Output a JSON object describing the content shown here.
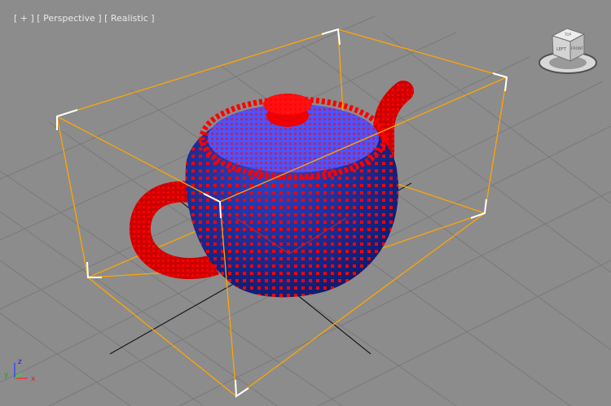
{
  "viewport": {
    "label": {
      "menu": "[ + ]",
      "view": "[ Perspective ]",
      "shading": "[ Realistic ]"
    },
    "viewcube": {
      "face_left": "LEFT",
      "face_front": "FRONT",
      "face_top": "TOP"
    },
    "axes": {
      "x": "x",
      "y": "y",
      "z": "z"
    },
    "colors": {
      "background": "#8c8c8c",
      "grid": "#7a7a7a",
      "selection_box": "#ffa500",
      "corner_brackets": "#ffffff",
      "teapot_body": "#1a2fa0",
      "teapot_lid": "#4a55ff",
      "vertex_points": "#ff0000"
    }
  }
}
